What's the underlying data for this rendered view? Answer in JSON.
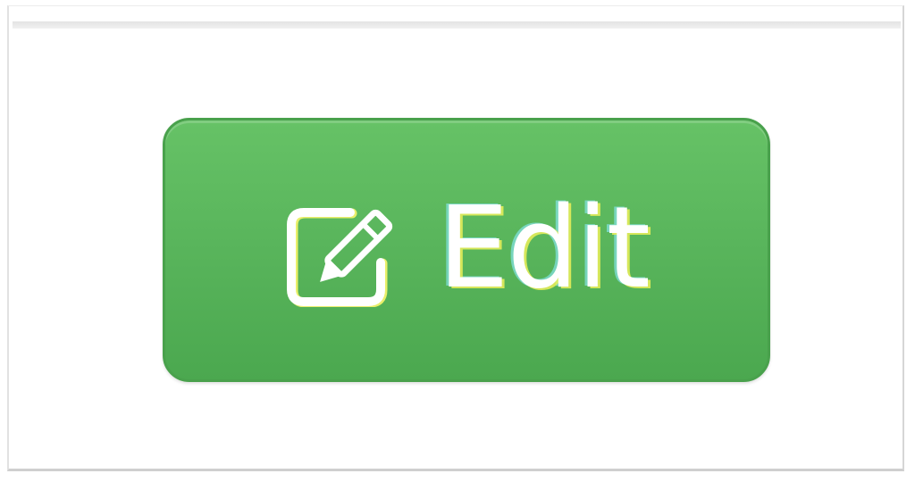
{
  "toolbar": {
    "edit_label": "Edit",
    "edit_icon": "edit-icon"
  },
  "colors": {
    "button_green": "#57b35a",
    "button_border": "#49a14c",
    "label": "#ffffff"
  }
}
